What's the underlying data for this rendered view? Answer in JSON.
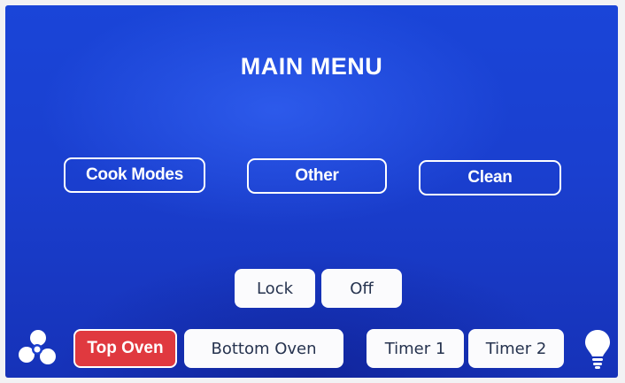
{
  "screen": {
    "title": "MAIN MENU"
  },
  "menu_buttons": {
    "cook_modes": "Cook Modes",
    "other": "Other",
    "clean": "Clean"
  },
  "controls": {
    "lock": "Lock",
    "off": "Off"
  },
  "bottom_bar": {
    "fan_icon": "fan-icon",
    "top_oven": "Top Oven",
    "bottom_oven": "Bottom Oven",
    "timer_1": "Timer 1",
    "timer_2": "Timer 2",
    "light_icon": "lightbulb-icon",
    "selected": "Top Oven"
  },
  "colors": {
    "screen_background": "#1a40d0",
    "selected_tab": "#e0393f",
    "button_text": "#26334f"
  }
}
